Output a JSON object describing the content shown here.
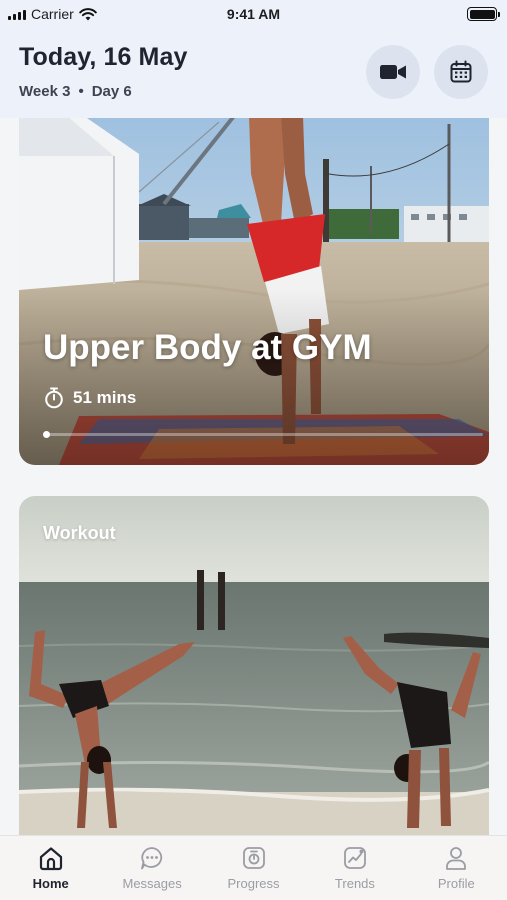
{
  "status_bar": {
    "carrier": "Carrier",
    "time": "9:41 AM"
  },
  "header": {
    "title": "Today, 16 May",
    "week": "Week 3",
    "separator": "•",
    "day": "Day 6",
    "video_button_icon": "video-camera-icon",
    "calendar_button_icon": "calendar-icon"
  },
  "cards": [
    {
      "title": "Upper Body at GYM",
      "duration": "51 mins",
      "image": "handstand-on-beach-photo",
      "duration_icon": "stopwatch-icon"
    },
    {
      "label": "Workout",
      "image": "two-people-handstand-at-shore-photo"
    }
  ],
  "tab_bar": {
    "tabs": [
      {
        "label": "Home",
        "icon": "home-icon",
        "active": true
      },
      {
        "label": "Messages",
        "icon": "chat-bubble-icon",
        "active": false
      },
      {
        "label": "Progress",
        "icon": "weight-scale-icon",
        "active": false
      },
      {
        "label": "Trends",
        "icon": "trend-chart-icon",
        "active": false
      },
      {
        "label": "Profile",
        "icon": "person-icon",
        "active": false
      }
    ]
  },
  "colors": {
    "header_bg": "#edf2fa",
    "active_tab": "#1f2430",
    "inactive_tab": "#9a9da4"
  }
}
